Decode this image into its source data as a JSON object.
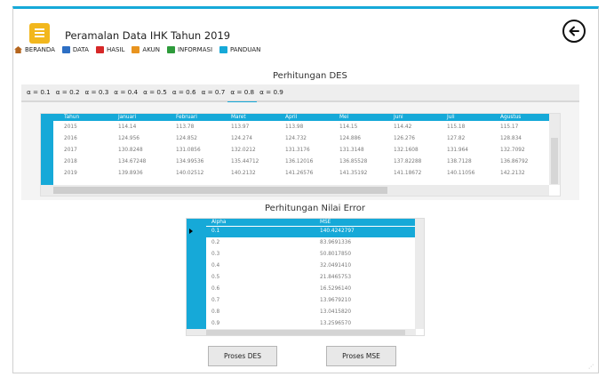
{
  "app": {
    "title": "Peramalan Data IHK Tahun 2019"
  },
  "menu": [
    {
      "label": "BERANDA",
      "icon": "home-icon",
      "color": "#b5651d"
    },
    {
      "label": "DATA",
      "icon": "data-icon",
      "color": "#2d6fc4"
    },
    {
      "label": "HASIL",
      "icon": "result-icon",
      "color": "#d62828"
    },
    {
      "label": "AKUN",
      "icon": "account-icon",
      "color": "#e8941f"
    },
    {
      "label": "INFORMASI",
      "icon": "info-icon",
      "color": "#2e9b3b"
    },
    {
      "label": "PANDUAN",
      "icon": "guide-icon",
      "color": "#16a9d8"
    }
  ],
  "des": {
    "title": "Perhitungan DES",
    "alpha_tabs": [
      "α = 0.1",
      "α = 0.2",
      "α = 0.3",
      "α = 0.4",
      "α = 0.5",
      "α = 0.6",
      "α = 0.7",
      "α = 0.8",
      "α = 0.9"
    ],
    "active_tab": 7,
    "columns": [
      "Tahun",
      "Januari",
      "Februari",
      "Maret",
      "April",
      "Mei",
      "Juni",
      "Juli",
      "Agustus"
    ],
    "rows": [
      [
        "2015",
        "114.14",
        "113.78",
        "113.97",
        "113.98",
        "114.15",
        "114.42",
        "115.18",
        "115.17"
      ],
      [
        "2016",
        "124.956",
        "124.852",
        "124.274",
        "124.732",
        "124.886",
        "126.276",
        "127.82",
        "128.834"
      ],
      [
        "2017",
        "130.8248",
        "131.0856",
        "132.0212",
        "131.3176",
        "131.3148",
        "132.1608",
        "131.964",
        "132.7092"
      ],
      [
        "2018",
        "134.67248",
        "134.99536",
        "135.44712",
        "136.12016",
        "136.85528",
        "137.82288",
        "138.7128",
        "136.86792"
      ],
      [
        "2019",
        "139.8936",
        "140.02512",
        "140.2132",
        "141.26576",
        "141.35192",
        "141.18672",
        "140.11056",
        "142.2132"
      ]
    ]
  },
  "error": {
    "title": "Perhitungan Nilai Error",
    "columns": [
      "Alpha",
      "MSE"
    ],
    "rows": [
      [
        "0.1",
        "140.4242797"
      ],
      [
        "0.2",
        "83.9691336"
      ],
      [
        "0.3",
        "50.8017850"
      ],
      [
        "0.4",
        "32.0491410"
      ],
      [
        "0.5",
        "21.8465753"
      ],
      [
        "0.6",
        "16.5296140"
      ],
      [
        "0.7",
        "13.9679210"
      ],
      [
        "0.8",
        "13.0415820"
      ],
      [
        "0.9",
        "13.2596570"
      ]
    ],
    "selected_row": 0
  },
  "buttons": {
    "proses_des": "Proses DES",
    "proses_mse": "Proses MSE"
  },
  "colors": {
    "accent": "#16a9d8",
    "app_icon": "#f2b71d"
  }
}
